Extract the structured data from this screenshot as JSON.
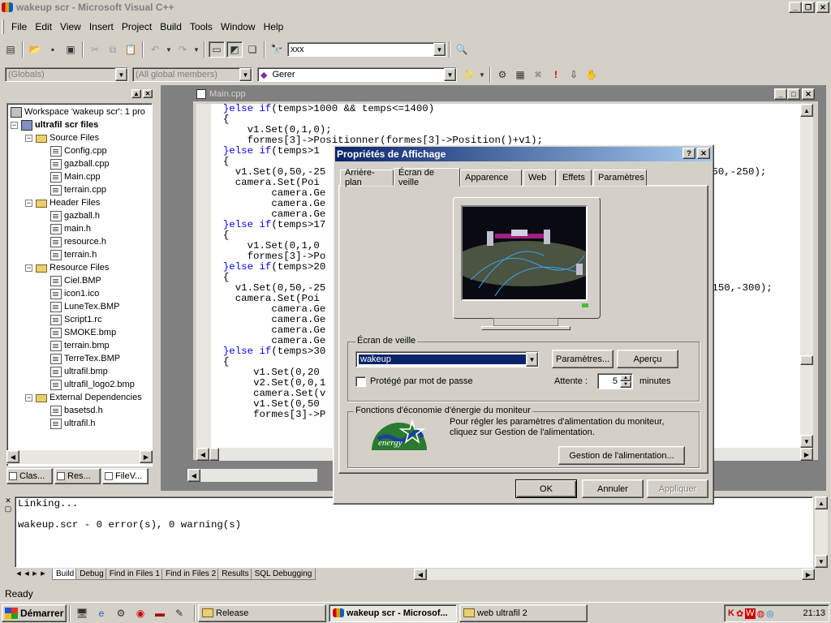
{
  "app": {
    "title": "wakeup scr - Microsoft Visual C++",
    "menu": [
      "File",
      "Edit",
      "View",
      "Insert",
      "Project",
      "Build",
      "Tools",
      "Window",
      "Help"
    ],
    "find_combo": "xxx",
    "scope_combo": "(Globals)",
    "members_combo": "(All global members)",
    "function_combo": "Gerer"
  },
  "workspace": {
    "items": [
      {
        "label": "Workspace 'wakeup scr': 1 pro",
        "type": "ws",
        "level": 0,
        "exp": ""
      },
      {
        "label": "ultrafil scr files",
        "type": "proj",
        "level": 0,
        "exp": "−",
        "bold": true
      },
      {
        "label": "Source Files",
        "type": "folder",
        "level": 1,
        "exp": "−"
      },
      {
        "label": "Config.cpp",
        "type": "file",
        "level": 2
      },
      {
        "label": "gazball.cpp",
        "type": "file",
        "level": 2
      },
      {
        "label": "Main.cpp",
        "type": "file",
        "level": 2
      },
      {
        "label": "terrain.cpp",
        "type": "file",
        "level": 2
      },
      {
        "label": "Header Files",
        "type": "folder",
        "level": 1,
        "exp": "−"
      },
      {
        "label": "gazball.h",
        "type": "file",
        "level": 2
      },
      {
        "label": "main.h",
        "type": "file",
        "level": 2
      },
      {
        "label": "resource.h",
        "type": "file",
        "level": 2
      },
      {
        "label": "terrain.h",
        "type": "file",
        "level": 2
      },
      {
        "label": "Resource Files",
        "type": "folder",
        "level": 1,
        "exp": "−"
      },
      {
        "label": "Ciel.BMP",
        "type": "file",
        "level": 2
      },
      {
        "label": "icon1.ico",
        "type": "file",
        "level": 2
      },
      {
        "label": "LuneTex.BMP",
        "type": "file",
        "level": 2
      },
      {
        "label": "Script1.rc",
        "type": "file",
        "level": 2
      },
      {
        "label": "SMOKE.bmp",
        "type": "file",
        "level": 2
      },
      {
        "label": "terrain.bmp",
        "type": "file",
        "level": 2
      },
      {
        "label": "TerreTex.BMP",
        "type": "file",
        "level": 2
      },
      {
        "label": "ultrafil.bmp",
        "type": "file",
        "level": 2
      },
      {
        "label": "ultrafil_logo2.bmp",
        "type": "file",
        "level": 2
      },
      {
        "label": "External Dependencies",
        "type": "folder",
        "level": 1,
        "exp": "−"
      },
      {
        "label": "basetsd.h",
        "type": "file",
        "level": 2
      },
      {
        "label": "ultrafil.h",
        "type": "file",
        "level": 2
      }
    ],
    "tabs": [
      "Clas...",
      "Res...",
      "FileV..."
    ]
  },
  "editor": {
    "title": "Main.cpp",
    "lines": [
      {
        "indent": "  ",
        "kw": "}else if",
        "rest": "(temps>1000 && temps<=1400)"
      },
      {
        "indent": "  ",
        "kw": "",
        "rest": "{"
      },
      {
        "indent": "      ",
        "kw": "",
        "rest": "v1.Set(0,1,0);"
      },
      {
        "indent": "      ",
        "kw": "",
        "rest": "formes[3]->Positionner(formes[3]->Position()+v1);"
      },
      {
        "indent": "  ",
        "kw": "}else if",
        "rest": "(temps>1"
      },
      {
        "indent": "  ",
        "kw": "",
        "rest": "{"
      },
      {
        "indent": "    ",
        "kw": "",
        "rest": "v1.Set(0,50,-25"
      },
      {
        "indent": "    ",
        "kw": "",
        "rest": "camera.Set(Poi"
      },
      {
        "indent": "          ",
        "kw": "",
        "rest": "camera.Ge"
      },
      {
        "indent": "          ",
        "kw": "",
        "rest": "camera.Ge"
      },
      {
        "indent": "          ",
        "kw": "",
        "rest": "camera.Ge"
      },
      {
        "indent": "  ",
        "kw": "}else if",
        "rest": "(temps>17"
      },
      {
        "indent": "  ",
        "kw": "",
        "rest": "{"
      },
      {
        "indent": "      ",
        "kw": "",
        "rest": "v1.Set(0,1,0"
      },
      {
        "indent": "      ",
        "kw": "",
        "rest": "formes[3]->Po"
      },
      {
        "indent": "  ",
        "kw": "}else if",
        "rest": "(temps>20"
      },
      {
        "indent": "  ",
        "kw": "",
        "rest": "{"
      },
      {
        "indent": "    ",
        "kw": "",
        "rest": "v1.Set(0,50,-25"
      },
      {
        "indent": "    ",
        "kw": "",
        "rest": "camera.Set(Poi"
      },
      {
        "indent": "          ",
        "kw": "",
        "rest": "camera.Ge"
      },
      {
        "indent": "          ",
        "kw": "",
        "rest": "camera.Ge"
      },
      {
        "indent": "          ",
        "kw": "",
        "rest": "camera.Ge"
      },
      {
        "indent": "          ",
        "kw": "",
        "rest": "camera.Ge"
      },
      {
        "indent": "  ",
        "kw": "}else if",
        "rest": "(temps>30"
      },
      {
        "indent": "  ",
        "kw": "",
        "rest": "{"
      },
      {
        "indent": "       ",
        "kw": "",
        "rest": "v1.Set(0,20"
      },
      {
        "indent": "       ",
        "kw": "",
        "rest": "v2.Set(0,0,1"
      },
      {
        "indent": "       ",
        "kw": "",
        "rest": "camera.Set(v"
      },
      {
        "indent": "",
        "kw": "",
        "rest": ""
      },
      {
        "indent": "       ",
        "kw": "",
        "rest": "v1.Set(0,50"
      },
      {
        "indent": "       ",
        "kw": "",
        "rest": "formes[3]->P"
      }
    ],
    "right_fragments": [
      {
        "text": ",50,-250);",
        "line": 6
      },
      {
        "text": ",150,-300);",
        "line": 17
      }
    ]
  },
  "output": {
    "lines": [
      "Linking...",
      "",
      "wakeup.scr - 0 error(s), 0 warning(s)"
    ],
    "tabs": [
      "Build",
      "Debug",
      "Find in Files 1",
      "Find in Files 2",
      "Results",
      "SQL Debugging"
    ]
  },
  "status": {
    "text": "Ready"
  },
  "dialog": {
    "title": "Propriétés de Affichage",
    "tabs": [
      "Arrière-plan",
      "Écran de veille",
      "Apparence",
      "Web",
      "Effets",
      "Paramètres"
    ],
    "active_tab": 1,
    "group1_label": "Écran de veille",
    "screensaver_value": "wakeup",
    "settings_button": "Paramètres...",
    "preview_button": "Aperçu",
    "password_label": "Protégé par mot de passe",
    "password_checked": false,
    "wait_label": "Attente :",
    "wait_value": "5",
    "wait_unit": "minutes",
    "group2_label": "Fonctions d'économie d'énergie du moniteur",
    "energy_text": "Pour régler les paramètres d'alimentation du moniteur, cliquez sur Gestion de l'alimentation.",
    "energy_logo_text": "energy",
    "power_button": "Gestion de l'alimentation...",
    "ok_button": "OK",
    "cancel_button": "Annuler",
    "apply_button": "Appliquer"
  },
  "taskbar": {
    "start_label": "Démarrer",
    "tasks": [
      "Release",
      "wakeup scr - Microsof...",
      "web ultrafil 2"
    ],
    "active_task": 1,
    "clock": "21:13"
  },
  "colors": {
    "dialog_title": "#0a246a",
    "keyword": "#0000ff",
    "desktop": "#d4d0c8"
  }
}
